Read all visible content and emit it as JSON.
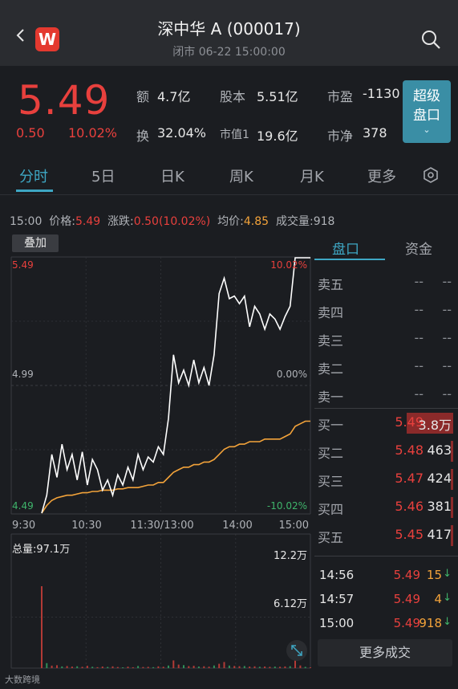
{
  "header": {
    "title": "深中华 A (000017)",
    "subtitle": "闭市  06-22 15:00:00",
    "badge": "W"
  },
  "quote": {
    "price": "5.49",
    "change": "0.50",
    "change_pct": "10.02%",
    "stats": [
      {
        "label": "额",
        "value": "4.7亿"
      },
      {
        "label": "股本",
        "value": "5.51亿"
      },
      {
        "label": "市盈",
        "value": "-1130"
      },
      {
        "label": "换",
        "value": "32.04%"
      },
      {
        "label": "市值1",
        "value": "19.6亿"
      },
      {
        "label": "市净",
        "value": "378"
      }
    ],
    "super_button": [
      "超级",
      "盘口"
    ]
  },
  "tabs": [
    "分时",
    "5日",
    "日K",
    "周K",
    "月K",
    "更多"
  ],
  "info_row": {
    "time": "15:00",
    "price_label": "价格:",
    "price": "5.49",
    "change_label": "涨跌:",
    "change": "0.50(10.02%)",
    "avg_label": "均价:",
    "avg": "4.85",
    "vol_label": "成交量:",
    "vol": "918"
  },
  "chart": {
    "overlay_label": "叠加",
    "y_labels": {
      "top": "5.49",
      "mid": "4.99",
      "bottom": "4.49"
    },
    "pct_labels": {
      "top": "10.02%",
      "mid": "0.00%",
      "bottom": "-10.02%"
    },
    "x_labels": [
      "9:30",
      "10:30",
      "11:30/13:00",
      "14:00",
      "15:00"
    ],
    "volume_title": "总量:97.1万",
    "volume_labels": {
      "top": "12.2万",
      "mid": "6.12万"
    }
  },
  "chart_data": {
    "type": "line",
    "ylim": [
      4.49,
      5.49
    ],
    "series": [
      {
        "values": [
          4.49,
          4.56,
          4.72,
          4.63,
          4.76,
          4.66,
          4.72,
          4.62,
          4.73,
          4.6,
          4.7,
          4.66,
          4.58,
          4.62,
          4.56,
          4.64,
          4.6,
          4.67,
          4.62,
          4.72,
          4.66,
          4.71,
          4.69,
          4.75,
          4.72,
          4.86,
          5.11,
          5.0,
          5.05,
          4.99,
          5.09,
          5.0,
          5.06,
          4.99,
          5.11,
          5.35,
          5.41,
          5.33,
          5.34,
          5.31,
          5.34,
          5.22,
          5.3,
          5.27,
          5.21,
          5.27,
          5.25,
          5.21,
          5.26,
          5.3,
          5.49,
          5.49,
          5.49,
          5.49
        ]
      },
      {
        "values": [
          4.49,
          4.52,
          4.54,
          4.55,
          4.555,
          4.56,
          4.56,
          4.565,
          4.57,
          4.57,
          4.575,
          4.575,
          4.58,
          4.58,
          4.58,
          4.585,
          4.585,
          4.59,
          4.59,
          4.59,
          4.595,
          4.6,
          4.6,
          4.61,
          4.61,
          4.63,
          4.65,
          4.66,
          4.67,
          4.67,
          4.68,
          4.68,
          4.69,
          4.69,
          4.7,
          4.72,
          4.74,
          4.75,
          4.75,
          4.76,
          4.76,
          4.77,
          4.77,
          4.77,
          4.78,
          4.78,
          4.78,
          4.78,
          4.79,
          4.8,
          4.83,
          4.84,
          4.85,
          4.85
        ]
      }
    ],
    "volume_ylim": [
      0,
      122000
    ],
    "volume": [
      98000,
      6000,
      3000,
      3500,
      2000,
      2500,
      1800,
      2200,
      1500,
      2800,
      1600,
      1200,
      1900,
      1400,
      2100,
      1300,
      1000,
      1700,
      1100,
      2600,
      1300,
      1500,
      1200,
      2100,
      1600,
      3100,
      9200,
      4200,
      3600,
      2400,
      2800,
      1900,
      2200,
      1700,
      3200,
      5200,
      7300,
      3100,
      2600,
      2300,
      2500,
      1800,
      2100,
      1600,
      1900,
      1500,
      1800,
      1600,
      2000,
      2300,
      9800,
      3200,
      1500,
      900
    ]
  },
  "orderbook": {
    "tab_pankou": "盘口",
    "tab_zijin": "资金",
    "sells": [
      {
        "label": "卖五",
        "price": "--",
        "vol": "--"
      },
      {
        "label": "卖四",
        "price": "--",
        "vol": "--"
      },
      {
        "label": "卖三",
        "price": "--",
        "vol": "--"
      },
      {
        "label": "卖二",
        "price": "--",
        "vol": "--"
      },
      {
        "label": "卖一",
        "price": "--",
        "vol": "--"
      }
    ],
    "buys": [
      {
        "label": "买一",
        "price": "5.49",
        "vol": "3.8万"
      },
      {
        "label": "买二",
        "price": "5.48",
        "vol": "463"
      },
      {
        "label": "买三",
        "price": "5.47",
        "vol": "424"
      },
      {
        "label": "买四",
        "price": "5.46",
        "vol": "381"
      },
      {
        "label": "买五",
        "price": "5.45",
        "vol": "417"
      }
    ]
  },
  "trades": [
    {
      "time": "14:56",
      "price": "5.49",
      "vol": "15",
      "dir": "↓"
    },
    {
      "time": "14:57",
      "price": "5.49",
      "vol": "4",
      "dir": "↓"
    },
    {
      "time": "15:00",
      "price": "5.49",
      "vol": "918",
      "dir": "↓"
    }
  ],
  "more_trades": "更多成交",
  "watermark": "大数跨境",
  "colors": {
    "up": "#e8403d",
    "accent": "#3ea7c4",
    "avg": "#f3a33a",
    "down": "#3fb46b"
  }
}
